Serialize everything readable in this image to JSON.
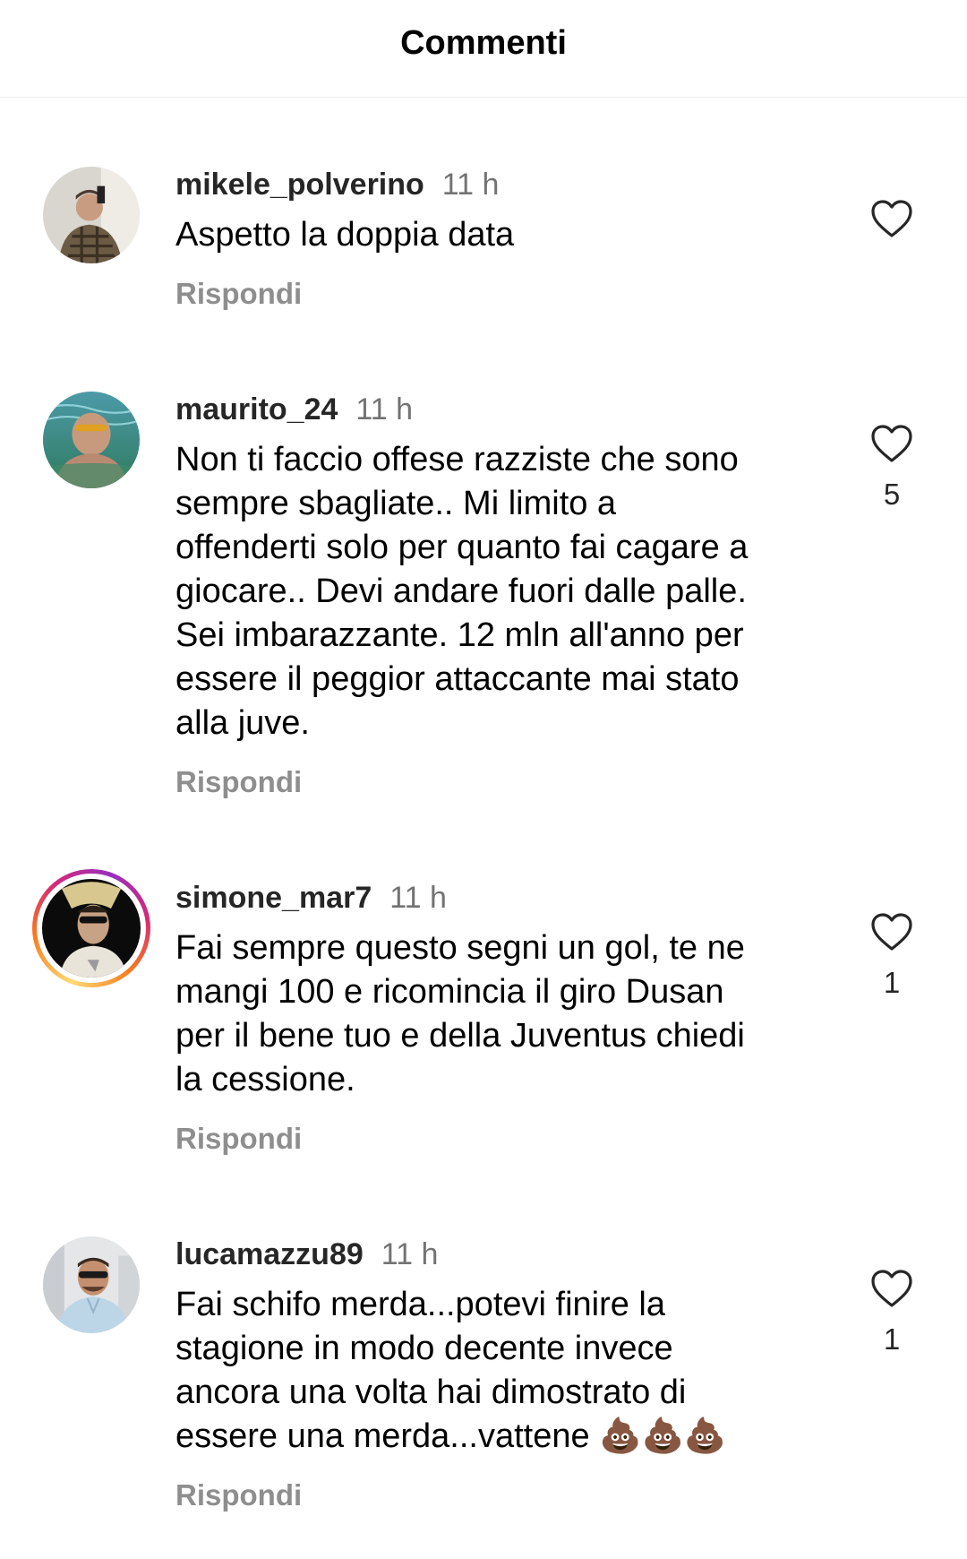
{
  "header": {
    "title": "Commenti"
  },
  "comments": [
    {
      "username": "mikele_polverino",
      "time": "11 h",
      "text": "Aspetto la doppia data",
      "reply": "Rispondi",
      "likes": ""
    },
    {
      "username": "maurito_24",
      "time": "11 h",
      "text": "Non ti faccio offese razziste che sono\nsempre sbagliate.. Mi limito a\noffenderti solo per quanto fai cagare a\ngiocare.. Devi andare fuori dalle palle.\nSei imbarazzante. 12 mln all'anno per\nessere il peggior attaccante mai stato\nalla juve.",
      "reply": "Rispondi",
      "likes": "5"
    },
    {
      "username": "simone_mar7",
      "time": "11 h",
      "text": "Fai sempre questo segni un gol, te ne\nmangi 100 e ricomincia il giro Dusan\nper il bene tuo e della Juventus chiedi\nla cessione.",
      "reply": "Rispondi",
      "likes": "1"
    },
    {
      "username": "lucamazzu89",
      "time": "11 h",
      "text": "Fai schifo merda...potevi finire la\nstagione in modo decente invece\nancora una volta hai dimostrato di\nessere una merda...vattene 💩💩💩",
      "reply": "Rispondi",
      "likes": "1"
    }
  ]
}
